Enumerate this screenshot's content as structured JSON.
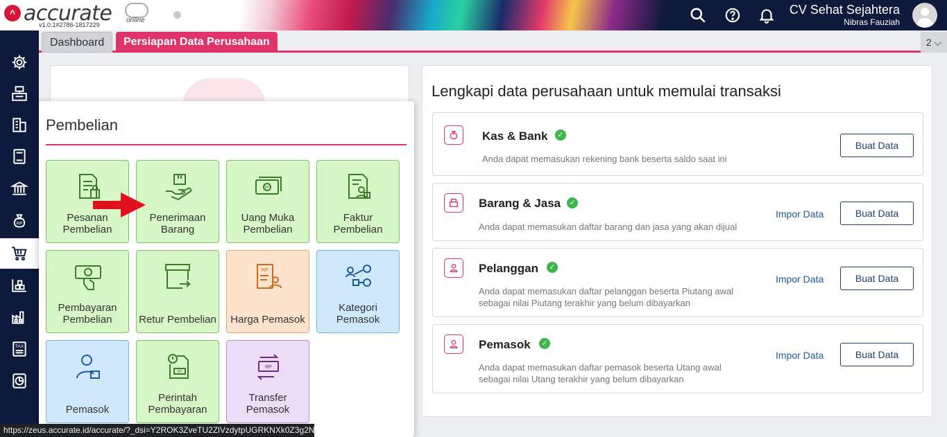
{
  "header": {
    "logo_text": "accurate",
    "logo_sub": "online",
    "version": "v1.0.1#2786-1817229",
    "company_name": "CV Sehat Sejahtera",
    "user_name": "Nibras Fauziah",
    "icons": [
      "search-icon",
      "help-icon",
      "bell-icon",
      "avatar"
    ]
  },
  "tabs": {
    "dashboard": "Dashboard",
    "prep": "Persiapan Data Perusahaan",
    "count": "2 ⌵"
  },
  "sidebar": {
    "items": [
      "gear-icon",
      "cashier-icon",
      "building-icon",
      "book-icon",
      "bank-icon",
      "money-bag-icon",
      "cart-icon",
      "warehouse-icon",
      "factory-icon",
      "tax-icon",
      "report-icon"
    ],
    "active": "cart-icon"
  },
  "popup": {
    "title": "Pembelian",
    "tiles": [
      {
        "label": "Pesanan Pembelian",
        "color": "green"
      },
      {
        "label": "Penerimaan Barang",
        "color": "green"
      },
      {
        "label": "Uang Muka Pembelian",
        "color": "green"
      },
      {
        "label": "Faktur Pembelian",
        "color": "green"
      },
      {
        "label": "Pembayaran Pembelian",
        "color": "green"
      },
      {
        "label": "Retur Pembelian",
        "color": "green"
      },
      {
        "label": "Harga Pemasok",
        "color": "orange"
      },
      {
        "label": "Kategori Pemasok",
        "color": "blue"
      },
      {
        "label": "Pemasok",
        "color": "blue"
      },
      {
        "label": "Perintah Pembayaran",
        "color": "green"
      },
      {
        "label": "Transfer Pemasok",
        "color": "purple"
      }
    ]
  },
  "right": {
    "title": "Lengkapi data perusahaan untuk memulai transaksi",
    "tasks": [
      {
        "title": "Kas & Bank",
        "desc1": "Anda dapat memasukan rekening bank beserta saldo saat ini",
        "desc2": "",
        "import": "",
        "create": "Buat Data"
      },
      {
        "title": "Barang & Jasa",
        "desc1": "Anda dapat memasukan daftar barang dan jasa yang akan dijual",
        "desc2": "",
        "import": "Impor Data",
        "create": "Buat Data"
      },
      {
        "title": "Pelanggan",
        "desc1": "Anda dapat memasukan daftar pelanggan beserta Piutang awal",
        "desc2": "sebagai nilai Piutang terakhir yang belum dibayarkan",
        "import": "Impor Data",
        "create": "Buat Data"
      },
      {
        "title": "Pemasok",
        "desc1": "Anda dapat memasukan daftar pemasok beserta Utang awal",
        "desc2": "sebagai nilai Utang terakhir yang belum dibayarkan",
        "import": "Impor Data",
        "create": "Buat Data"
      }
    ]
  },
  "statusbar": {
    "url": "https://zeus.accurate.id/accurate/?_dsi=Y2ROK3ZveTU2ZlVzdytpUGRKNXk0Z3g2N..."
  },
  "colors": {
    "brand": "#e0336a",
    "navy": "#0e1a3c",
    "tile_green": "#d6f6c6",
    "check": "#3db64a",
    "arrow": "#e0111d"
  }
}
